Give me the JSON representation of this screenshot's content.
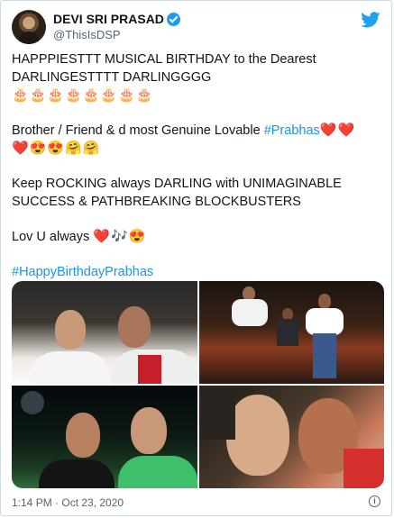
{
  "author": {
    "name": "DEVI SRI PRASAD",
    "handle": "@ThisIsDSP"
  },
  "tweet": {
    "line1": "HAPPPIESTTT MUSICAL BIRTHDAY to the Dearest\nDARLINGESTTTT DARLINGGGG",
    "cakes": "🎂🎂🎂🎂🎂🎂🎂🎂",
    "line2_text": "Brother / Friend & d most Genuine Lovable ",
    "line2_tag": "#Prabhas",
    "line2_emoji": "❤️❤️\n❤️😍😍🤗🤗",
    "line3": "Keep ROCKING always DARLING with UNIMAGINABLE\nSUCCESS & PATHBREAKING BLOCKBUSTERS",
    "line4_text": "Lov U always ",
    "line4_emoji": "❤️🎶😍",
    "hashtag": "#HappyBirthdayPrabhas"
  },
  "footer": {
    "timestamp": "1:14 PM · Oct 23, 2020",
    "info_symbol": "i"
  },
  "colors": {
    "link": "#1b95e0",
    "verified": "#1d9bf0",
    "twitter_blue": "#1da1f2",
    "muted": "#536471"
  }
}
